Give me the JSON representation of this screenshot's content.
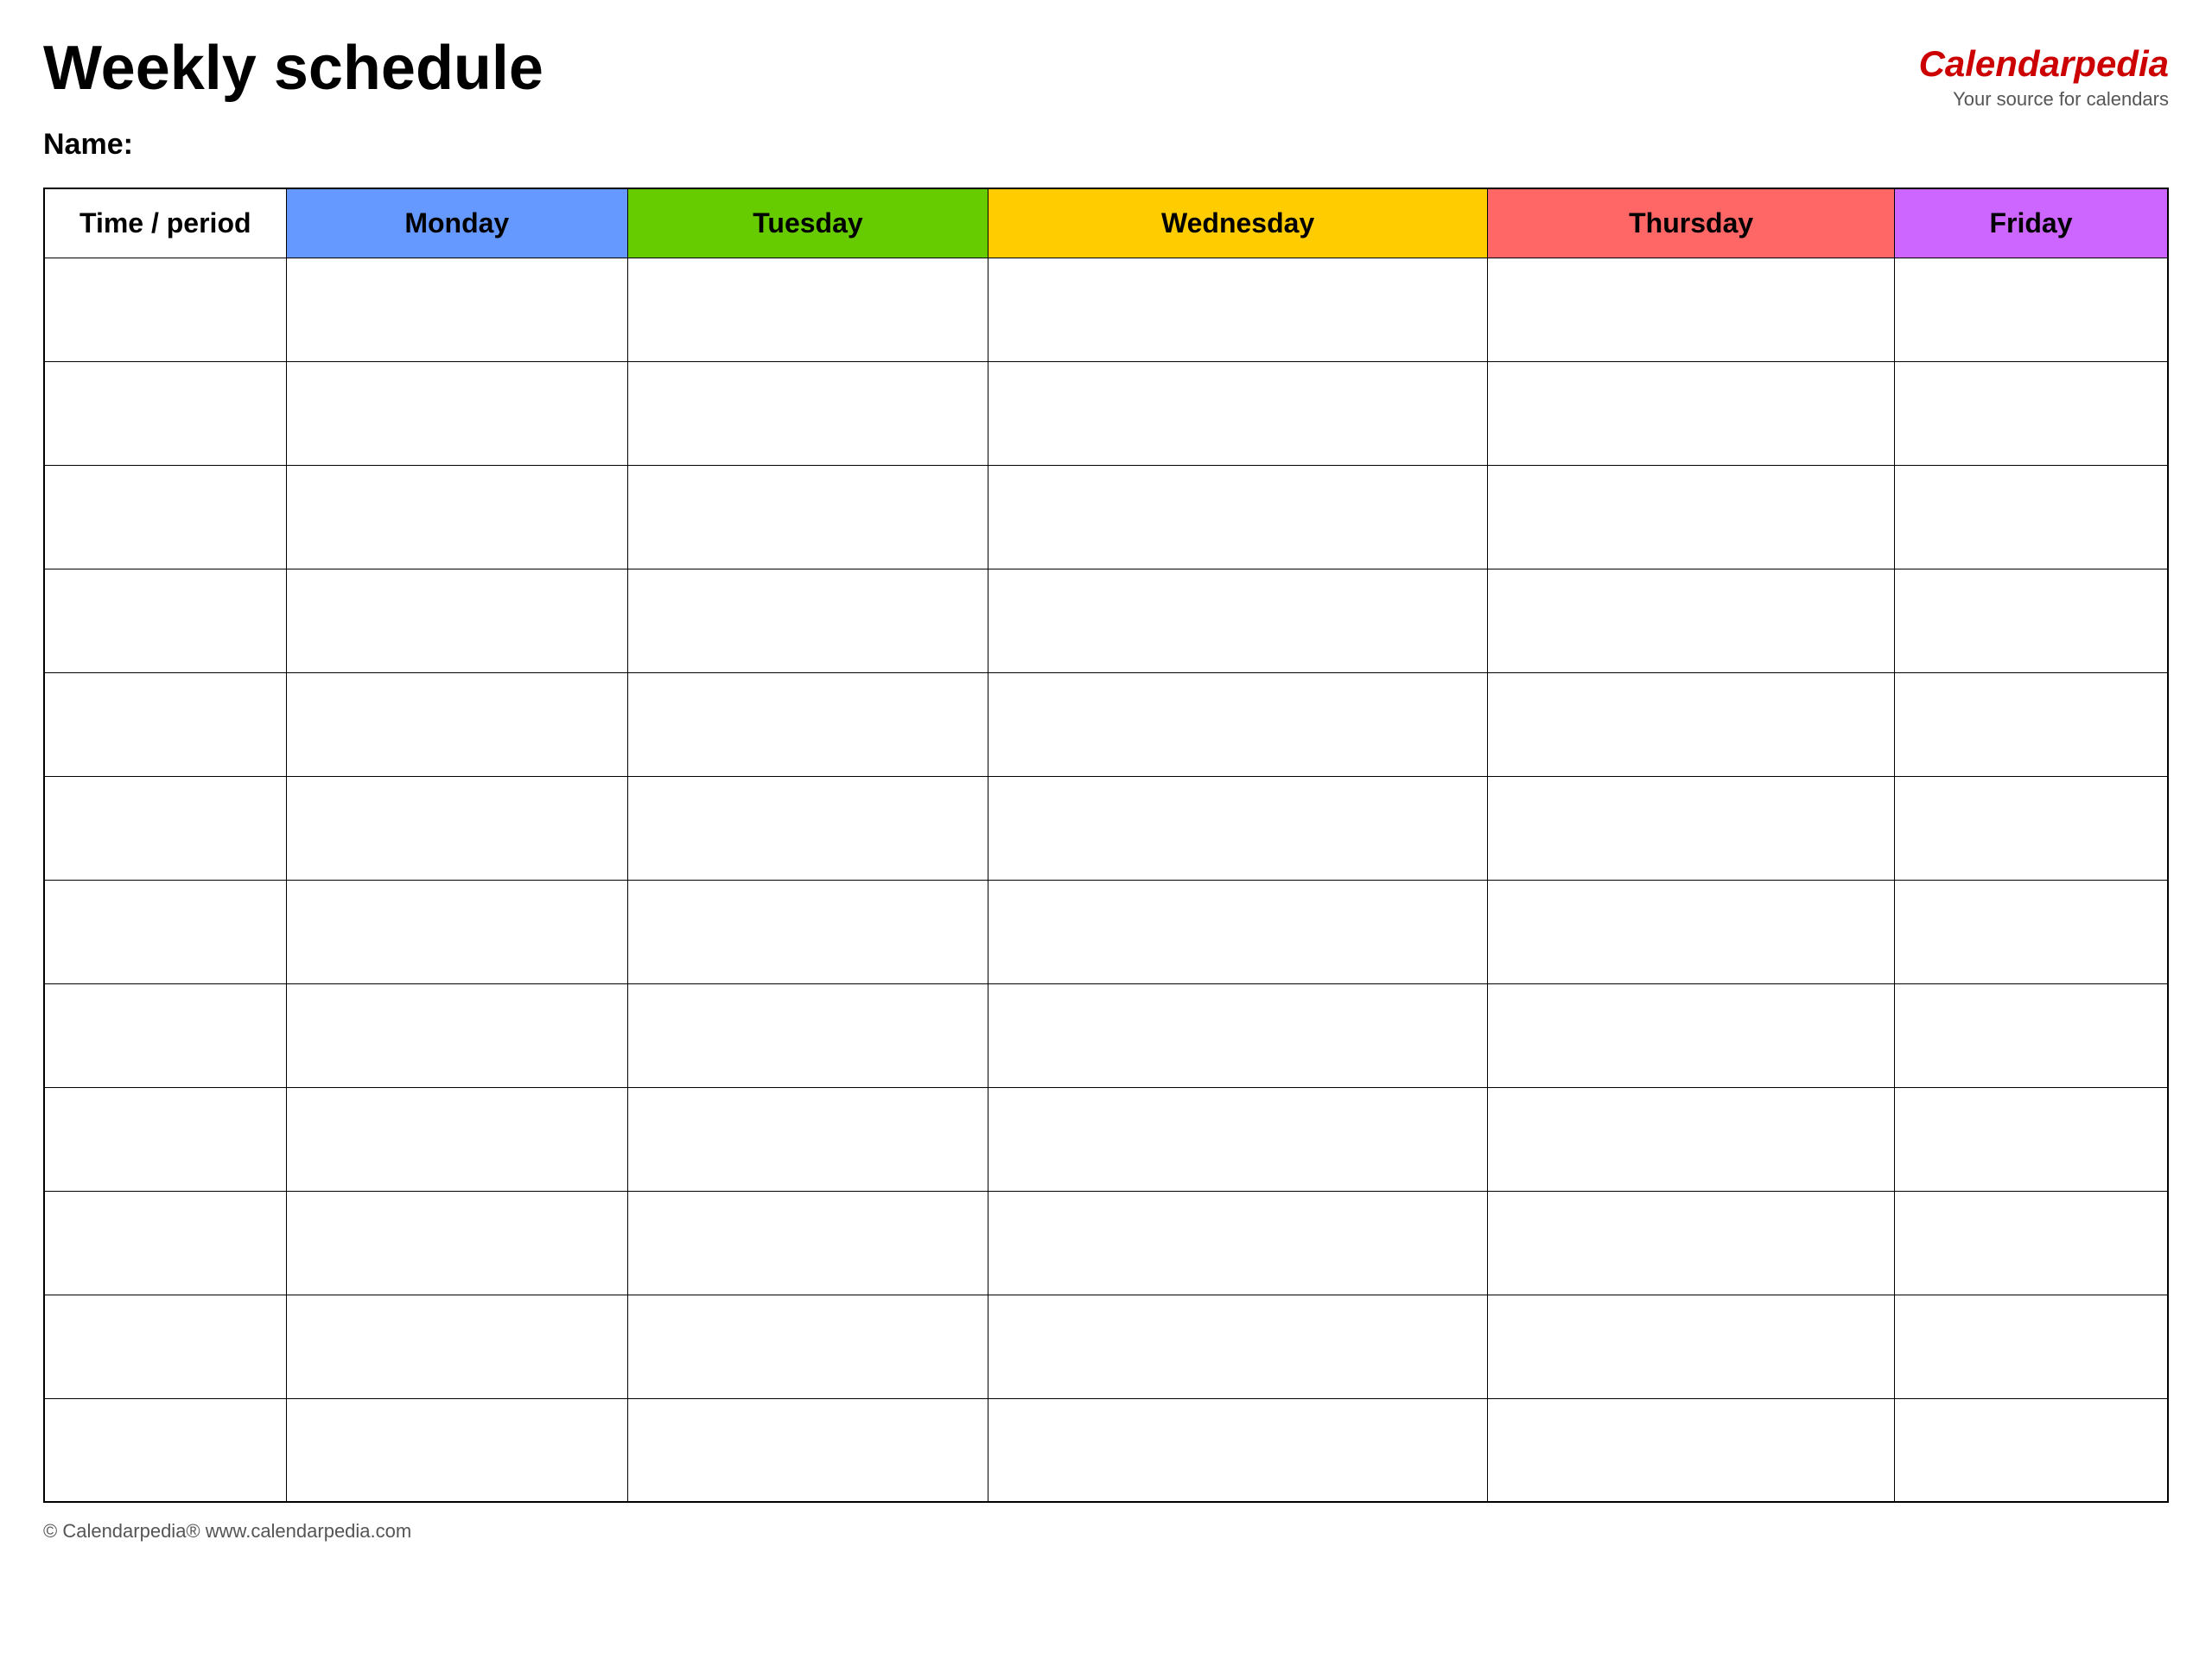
{
  "header": {
    "title": "Weekly schedule",
    "logo": {
      "calendar": "Calendar",
      "pedia": "pedia",
      "subtitle": "Your source for calendars"
    }
  },
  "name_label": "Name:",
  "table": {
    "columns": [
      {
        "id": "time",
        "label": "Time / period",
        "color": "white"
      },
      {
        "id": "monday",
        "label": "Monday",
        "color": "#6699ff"
      },
      {
        "id": "tuesday",
        "label": "Tuesday",
        "color": "#66cc00"
      },
      {
        "id": "wednesday",
        "label": "Wednesday",
        "color": "#ffcc00"
      },
      {
        "id": "thursday",
        "label": "Thursday",
        "color": "#ff6666"
      },
      {
        "id": "friday",
        "label": "Friday",
        "color": "#cc66ff"
      }
    ],
    "rows": 12
  },
  "footer": {
    "copyright": "© Calendarpedia®  www.calendarpedia.com"
  }
}
